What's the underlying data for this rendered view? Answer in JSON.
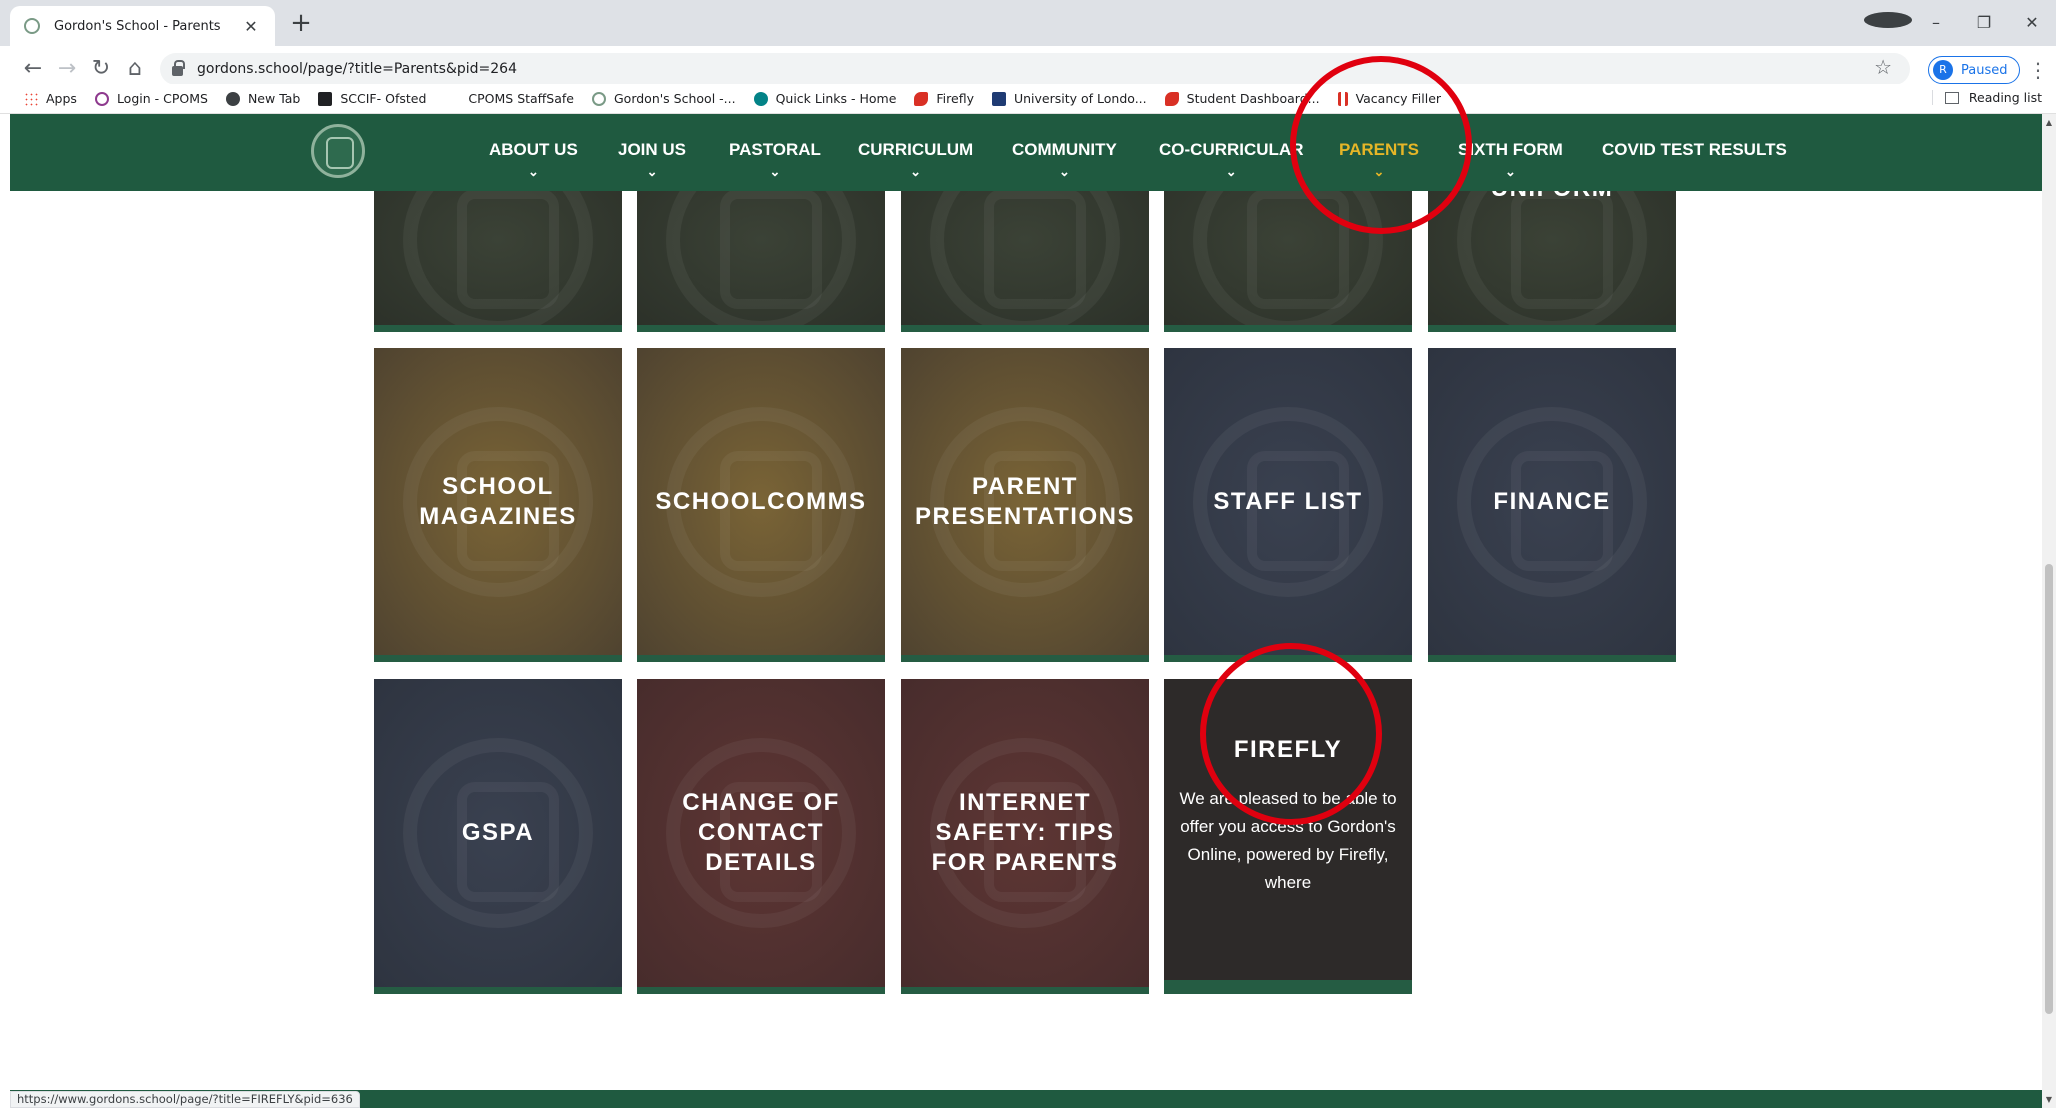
{
  "browser": {
    "tab_title": "Gordon's School - Parents",
    "tab_close": "✕",
    "new_tab": "+",
    "url": "gordons.school/page/?title=Parents&pid=264",
    "profile_initial": "R",
    "profile_status": "Paused",
    "window_controls": [
      "–",
      "❐",
      "✕"
    ],
    "back": "←",
    "forward": "→",
    "reload": "↻",
    "home": "⌂",
    "star": "☆",
    "menu": "⋮",
    "reading_list": "Reading list",
    "bookmarks": [
      {
        "label": "Apps",
        "icon": "apps-grid-icon",
        "color": "#1a73e8"
      },
      {
        "label": "Login - CPOMS",
        "icon": "cpoms-icon",
        "color": "#8e3a8e"
      },
      {
        "label": "New Tab",
        "icon": "globe-icon",
        "color": "#3c4043"
      },
      {
        "label": "SCCIF- Ofsted",
        "icon": "ofsted-icon",
        "color": "#202124"
      },
      {
        "label": "CPOMS StaffSafe",
        "icon": "",
        "color": "#ffffff"
      },
      {
        "label": "Gordon's School -...",
        "icon": "school-crest-icon",
        "color": "#7a9a86"
      },
      {
        "label": "Quick Links - Home",
        "icon": "sharepoint-icon",
        "color": "#038387"
      },
      {
        "label": "Firefly",
        "icon": "firefly-icon",
        "color": "#d93025"
      },
      {
        "label": "University of Londo...",
        "icon": "university-icon",
        "color": "#1f3b73"
      },
      {
        "label": "Student Dashboard...",
        "icon": "firefly-icon",
        "color": "#d93025"
      },
      {
        "label": "Vacancy Filler",
        "icon": "vacancy-icon",
        "color": "#d93025"
      }
    ],
    "status_url": "https://www.gordons.school/page/?title=FIREFLY&pid=636"
  },
  "site_nav": {
    "items": [
      {
        "label": "ABOUT US",
        "chevron": true,
        "active": false
      },
      {
        "label": "JOIN US",
        "chevron": true,
        "active": false
      },
      {
        "label": "PASTORAL",
        "chevron": true,
        "active": false
      },
      {
        "label": "CURRICULUM",
        "chevron": true,
        "active": false
      },
      {
        "label": "COMMUNITY",
        "chevron": true,
        "active": false
      },
      {
        "label": "CO-CURRICULAR",
        "chevron": true,
        "active": false
      },
      {
        "label": "PARENTS",
        "chevron": true,
        "active": true
      },
      {
        "label": "SIXTH FORM",
        "chevron": true,
        "active": false
      },
      {
        "label": "COVID TEST RESULTS",
        "chevron": false,
        "active": false
      }
    ],
    "active_color": "#e6b627",
    "background": "#1f5a40"
  },
  "tiles": {
    "row0": [
      {
        "title": ""
      },
      {
        "title": ""
      },
      {
        "title": ""
      },
      {
        "title": ""
      },
      {
        "title": "UNIFORM"
      }
    ],
    "row1": [
      {
        "title": "SCHOOL MAGAZINES"
      },
      {
        "title": "SCHOOLCOMMS"
      },
      {
        "title": "PARENT PRESENTATIONS"
      },
      {
        "title": "STAFF LIST"
      },
      {
        "title": "FINANCE"
      }
    ],
    "row2": [
      {
        "title": "GSPA"
      },
      {
        "title": "CHANGE OF CONTACT DETAILS"
      },
      {
        "title": "INTERNET SAFETY: TIPS FOR PARENTS"
      },
      {
        "title": "FIREFLY",
        "description": "We are pleased to be able to offer you access to Gordon's Online, powered by Firefly, where"
      }
    ]
  },
  "annotation_color": "#e0000f"
}
